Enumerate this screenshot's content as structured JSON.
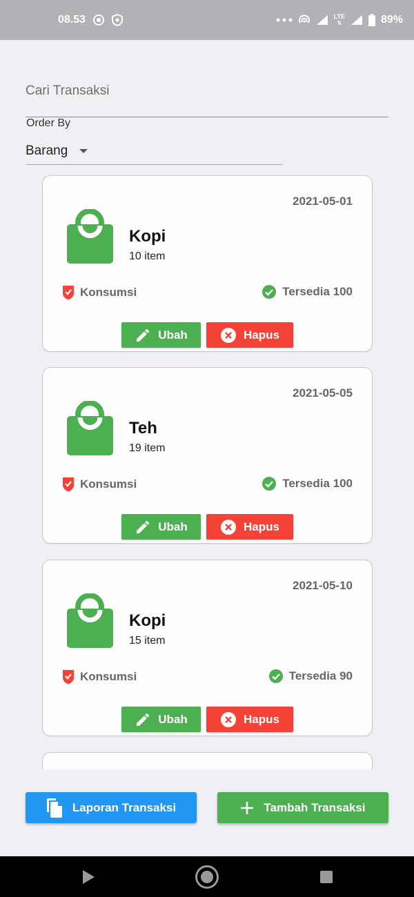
{
  "status_bar": {
    "time": "08.53",
    "network_label": "LTE",
    "battery": "89%"
  },
  "search": {
    "placeholder": "Cari Transaksi",
    "value": ""
  },
  "order_by": {
    "label": "Order By",
    "selected": "Barang"
  },
  "transactions": [
    {
      "date": "2021-05-01",
      "name": "Kopi",
      "quantity": "10 item",
      "category": "Konsumsi",
      "stock": "Tersedia 100",
      "edit_label": "Ubah",
      "delete_label": "Hapus"
    },
    {
      "date": "2021-05-05",
      "name": "Teh",
      "quantity": "19 item",
      "category": "Konsumsi",
      "stock": "Tersedia 100",
      "edit_label": "Ubah",
      "delete_label": "Hapus"
    },
    {
      "date": "2021-05-10",
      "name": "Kopi",
      "quantity": "15 item",
      "category": "Konsumsi",
      "stock": "Tersedia 90",
      "edit_label": "Ubah",
      "delete_label": "Hapus"
    }
  ],
  "actions": {
    "report_label": "Laporan Transaksi",
    "add_label": "Tambah Transaksi"
  },
  "colors": {
    "green": "#4caf50",
    "red": "#f44336",
    "blue": "#2196f3",
    "background": "#eff0f4"
  },
  "icons": {
    "bag": "shopping-bag-icon",
    "category": "shield-check-icon",
    "stock": "check-circle-icon",
    "edit": "pencil-icon",
    "delete": "close-circle-icon",
    "report": "copy-document-icon",
    "add": "plus-icon"
  }
}
